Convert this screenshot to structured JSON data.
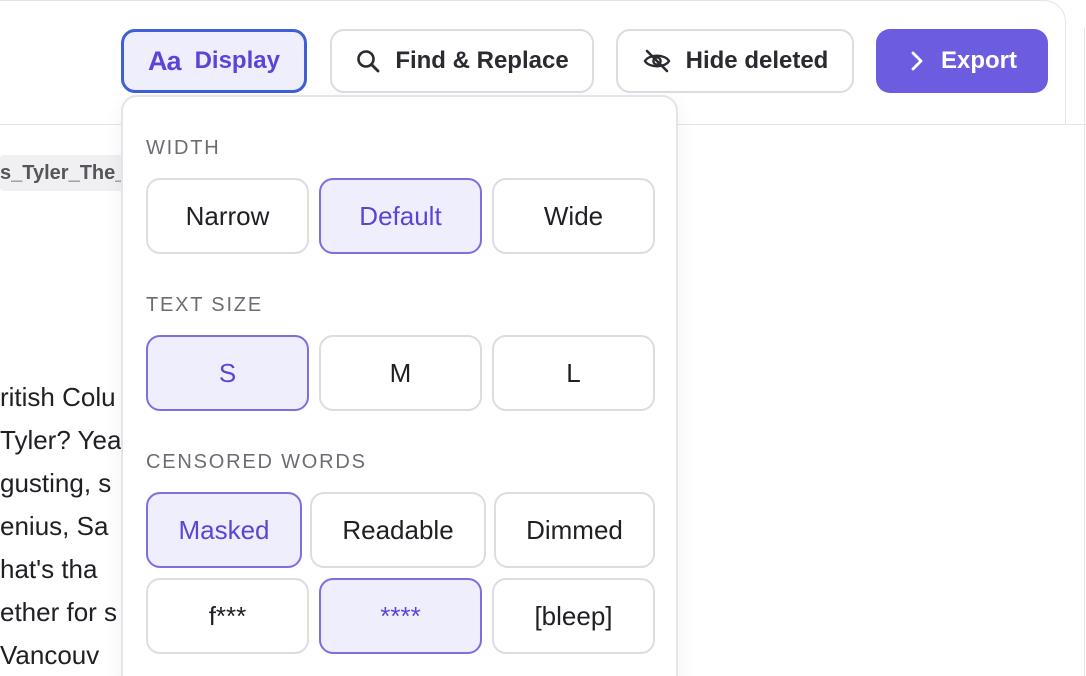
{
  "toolbar": {
    "display_label": "Display",
    "display_icon_text": "Aa",
    "find_label": "Find & Replace",
    "hide_label": "Hide deleted",
    "export_label": "Export"
  },
  "background": {
    "file_chip": "s_Tyler_The_",
    "lines": [
      "ritish Colu",
      "Tyler? Yea",
      "gusting, s",
      "enius, Sa",
      "hat's tha",
      "ether for s",
      " Vancouv"
    ]
  },
  "display_panel": {
    "width": {
      "label": "WIDTH",
      "options": [
        "Narrow",
        "Default",
        "Wide"
      ],
      "selected": "Default"
    },
    "text_size": {
      "label": "TEXT SIZE",
      "options": [
        "S",
        "M",
        "L"
      ],
      "selected": "S"
    },
    "censored_words": {
      "label": "CENSORED WORDS",
      "modes": [
        "Masked",
        "Readable",
        "Dimmed"
      ],
      "selected_mode": "Masked",
      "styles": [
        "f***",
        "****",
        "[bleep]"
      ],
      "selected_style": "****"
    }
  },
  "colors": {
    "accent": "#6b5ce0",
    "selected_bg": "#efeefd",
    "selected_border": "#7d6ee3",
    "focus_ring": "#3f5fd4"
  },
  "icons": [
    "text-size-icon",
    "search-icon",
    "eye-off-icon",
    "chevron-right-icon"
  ]
}
